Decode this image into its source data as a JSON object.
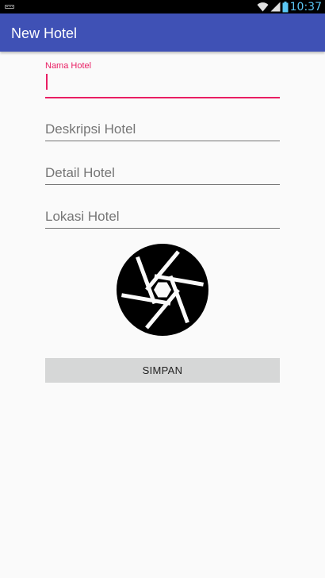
{
  "status_bar": {
    "time": "10:37",
    "icons": [
      "keyboard-icon",
      "wifi-icon",
      "signal-icon",
      "battery-icon"
    ],
    "text_color": "#5bc8f5"
  },
  "app_bar": {
    "title": "New Hotel",
    "color": "#3f51b5"
  },
  "form": {
    "nama_hotel": {
      "label": "Nama Hotel",
      "value": "",
      "focused": true
    },
    "deskripsi_hotel": {
      "placeholder": "Deskripsi Hotel",
      "value": ""
    },
    "detail_hotel": {
      "placeholder": "Detail Hotel",
      "value": ""
    },
    "lokasi_hotel": {
      "placeholder": "Lokasi Hotel",
      "value": ""
    },
    "image_icon": "camera-aperture-icon",
    "save_label": "SIMPAN"
  },
  "colors": {
    "accent": "#e91e63",
    "primary": "#3f51b5",
    "button_bg": "#d6d7d7"
  }
}
